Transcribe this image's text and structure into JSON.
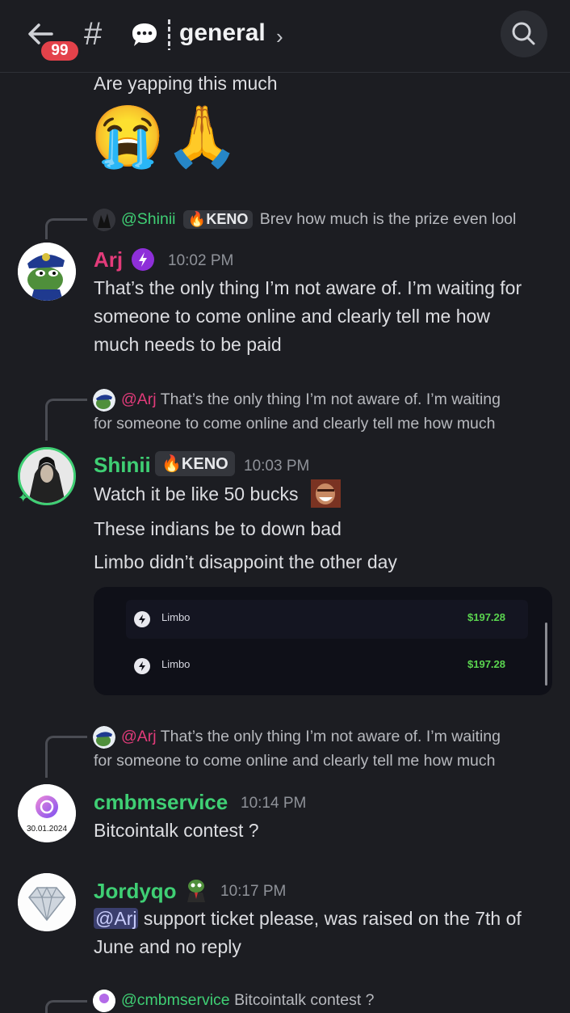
{
  "header": {
    "badge": "99",
    "hash": "#",
    "channel": "general",
    "chevron": "›"
  },
  "top_text": "Are yapping this much",
  "emojis": [
    "😭",
    "🙏"
  ],
  "messages": [
    {
      "reply": {
        "user": "@Shinii",
        "tag": "KENO",
        "text": "Brev how much is the prize even lool"
      },
      "user": "Arj",
      "user_color": "#e23b7a",
      "time": "10:02 PM",
      "lines": [
        "That’s the only thing I’m not aware of. I’m waiting for",
        "someone to come online and clearly tell me how",
        "much needs to be paid"
      ]
    },
    {
      "reply": {
        "user": "@Arj",
        "text1": "That’s the only thing I’m not aware of. I’m waiting",
        "text2": "for someone to come online and clearly tell me how much"
      },
      "user": "Shinii",
      "user_color": "#3fcf74",
      "tag": "KENO",
      "time": "10:03 PM",
      "lines": [
        "Watch it be like 50 bucks",
        "These indians be to down bad",
        "Limbo didn’t disappoint the other day"
      ],
      "embed": [
        {
          "label": "Limbo",
          "amount": "$197.28"
        },
        {
          "label": "Limbo",
          "amount": "$197.28"
        }
      ]
    },
    {
      "reply": {
        "user": "@Arj",
        "text1": "That’s the only thing I’m not aware of. I’m waiting",
        "text2": "for someone to come online and clearly tell me how much"
      },
      "user": "cmbmservice",
      "user_color": "#3fcf74",
      "avatar_date": "30.01.2024",
      "time": "10:14 PM",
      "lines": [
        "Bitcointalk contest ?"
      ]
    },
    {
      "user": "Jordyqo",
      "user_color": "#3fcf74",
      "time": "10:17 PM",
      "mention": "@Arj",
      "lines": [
        " support ticket please, was raised on the 7th of",
        "June and no reply"
      ]
    }
  ],
  "bottom_reply": {
    "user": "@cmbmservice",
    "text": "Bitcointalk contest ?"
  },
  "colors": {
    "background": "#1c1d22",
    "green_name": "#3fcf74",
    "pink_name": "#e23b7a",
    "embed_green": "#5ad44f"
  }
}
